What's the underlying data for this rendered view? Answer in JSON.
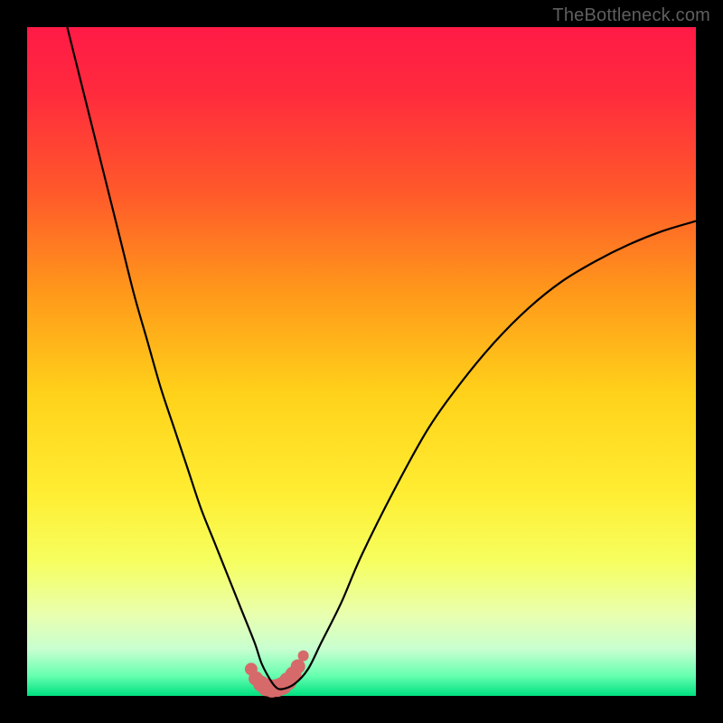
{
  "watermark": "TheBottleneck.com",
  "colors": {
    "background": "#000000",
    "gradient_stops": [
      {
        "offset": 0.0,
        "color": "#ff1a46"
      },
      {
        "offset": 0.1,
        "color": "#ff2b3d"
      },
      {
        "offset": 0.25,
        "color": "#ff5a2a"
      },
      {
        "offset": 0.4,
        "color": "#ff9a1a"
      },
      {
        "offset": 0.55,
        "color": "#ffd21a"
      },
      {
        "offset": 0.7,
        "color": "#ffee33"
      },
      {
        "offset": 0.8,
        "color": "#f6ff60"
      },
      {
        "offset": 0.88,
        "color": "#e8ffb0"
      },
      {
        "offset": 0.93,
        "color": "#c8ffd0"
      },
      {
        "offset": 0.97,
        "color": "#66ffb0"
      },
      {
        "offset": 1.0,
        "color": "#00e080"
      }
    ],
    "curve_stroke": "#000000",
    "marker_fill": "#d66a6a",
    "marker_stroke": "#c85a5a"
  },
  "chart_data": {
    "type": "line",
    "title": "",
    "xlabel": "",
    "ylabel": "",
    "xlim": [
      0,
      100
    ],
    "ylim": [
      0,
      100
    ],
    "grid": false,
    "series": [
      {
        "name": "bottleneck-curve",
        "x": [
          6,
          8,
          10,
          12,
          14,
          16,
          18,
          20,
          22,
          24,
          26,
          28,
          30,
          32,
          34,
          35,
          36,
          37,
          38,
          40,
          42,
          44,
          47,
          50,
          55,
          60,
          65,
          70,
          75,
          80,
          85,
          90,
          95,
          100
        ],
        "y": [
          100,
          92,
          84,
          76,
          68,
          60,
          53,
          46,
          40,
          34,
          28,
          23,
          18,
          13,
          8,
          5,
          3,
          1.5,
          1,
          1.8,
          4,
          8,
          14,
          21,
          31,
          40,
          47,
          53,
          58,
          62,
          65,
          67.5,
          69.5,
          71
        ]
      }
    ],
    "markers": {
      "name": "highlight-band",
      "x": [
        33.5,
        34.2,
        35.0,
        35.8,
        36.6,
        37.4,
        38.2,
        39.0,
        39.8,
        40.5,
        41.3
      ],
      "y": [
        4.0,
        2.6,
        1.8,
        1.3,
        1.1,
        1.2,
        1.5,
        2.2,
        3.2,
        4.4,
        6.0
      ],
      "r": [
        7,
        8,
        9,
        10,
        10,
        10,
        10,
        10,
        9,
        8,
        6
      ]
    }
  }
}
